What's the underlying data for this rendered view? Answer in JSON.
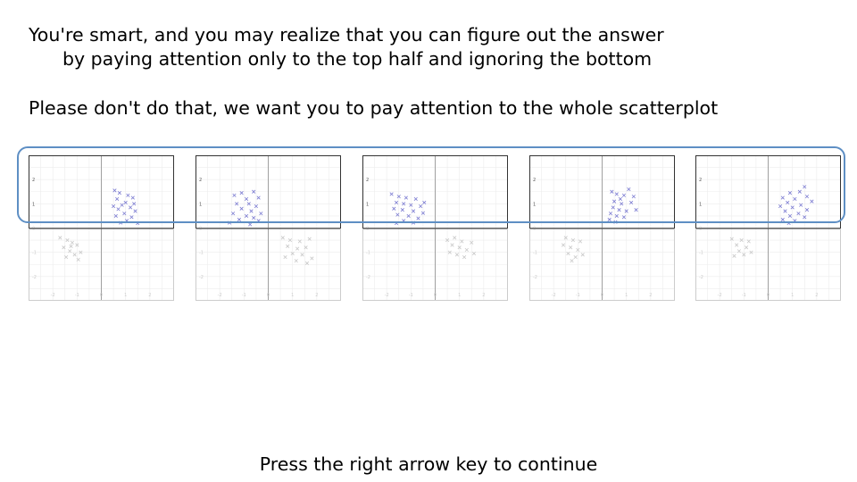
{
  "instructions": {
    "line1": "You're smart, and you may realize that you can figure out the answer",
    "line2": "by paying attention only to the top half and ignoring the bottom",
    "line3": "Please don't do that, we want you to pay attention to the whole scatterplot"
  },
  "footer": {
    "text": "Press the right arrow key to continue"
  },
  "colors": {
    "highlight": "#5e8fc4",
    "points_top": "#7b7bd1",
    "points_bottom": "#c8c8c8",
    "grid": "#ececec",
    "axis": "#a0a0a0",
    "frame_top": "#333333",
    "frame_bottom": "#cccccc"
  },
  "chart_data": [
    {
      "type": "scatter",
      "marker": "x",
      "xlim": [
        -3,
        3
      ],
      "ylim": [
        -3,
        3
      ],
      "y_ticks": [
        "2",
        "1",
        "0",
        "-1",
        "-2"
      ],
      "x_ticks": [
        "-2",
        "-1",
        "0",
        "1",
        "2"
      ],
      "points": [
        [
          0.55,
          1.55
        ],
        [
          0.75,
          1.45
        ],
        [
          1.1,
          1.35
        ],
        [
          1.3,
          1.25
        ],
        [
          0.65,
          1.2
        ],
        [
          1.0,
          1.05
        ],
        [
          0.85,
          0.95
        ],
        [
          1.2,
          0.85
        ],
        [
          0.7,
          0.78
        ],
        [
          1.4,
          0.7
        ],
        [
          0.95,
          0.6
        ],
        [
          0.6,
          0.5
        ],
        [
          1.25,
          0.45
        ],
        [
          1.05,
          0.3
        ],
        [
          0.8,
          0.22
        ],
        [
          1.5,
          0.2
        ],
        [
          0.5,
          0.9
        ],
        [
          1.35,
          1.0
        ],
        [
          -1.7,
          -0.4
        ],
        [
          -1.4,
          -0.5
        ],
        [
          -1.2,
          -0.6
        ],
        [
          -1.55,
          -0.8
        ],
        [
          -1.0,
          -0.7
        ],
        [
          -1.3,
          -0.95
        ],
        [
          -1.1,
          -1.1
        ],
        [
          -0.85,
          -1.0
        ],
        [
          -1.45,
          -1.2
        ],
        [
          -0.95,
          -1.3
        ],
        [
          -1.25,
          -0.75
        ]
      ]
    },
    {
      "type": "scatter",
      "marker": "x",
      "xlim": [
        -3,
        3
      ],
      "ylim": [
        -3,
        3
      ],
      "y_ticks": [
        "2",
        "1",
        "0",
        "-1",
        "-2"
      ],
      "x_ticks": [
        "-2",
        "-1",
        "0",
        "1",
        "2"
      ],
      "points": [
        [
          -1.4,
          1.35
        ],
        [
          -1.1,
          1.45
        ],
        [
          -0.6,
          1.5
        ],
        [
          -0.9,
          1.2
        ],
        [
          -0.4,
          1.25
        ],
        [
          -1.3,
          1.0
        ],
        [
          -0.8,
          1.0
        ],
        [
          -0.5,
          0.9
        ],
        [
          -1.1,
          0.8
        ],
        [
          -0.7,
          0.7
        ],
        [
          -1.45,
          0.6
        ],
        [
          -0.3,
          0.6
        ],
        [
          -0.9,
          0.5
        ],
        [
          -0.6,
          0.42
        ],
        [
          -1.2,
          0.35
        ],
        [
          -0.4,
          0.3
        ],
        [
          -1.6,
          0.22
        ],
        [
          -0.75,
          0.15
        ],
        [
          0.6,
          -0.4
        ],
        [
          0.9,
          -0.5
        ],
        [
          1.3,
          -0.55
        ],
        [
          1.7,
          -0.45
        ],
        [
          0.8,
          -0.75
        ],
        [
          1.2,
          -0.85
        ],
        [
          1.55,
          -0.8
        ],
        [
          1.0,
          -1.05
        ],
        [
          1.4,
          -1.1
        ],
        [
          0.7,
          -1.2
        ],
        [
          1.8,
          -1.25
        ],
        [
          1.15,
          -1.35
        ],
        [
          1.6,
          -1.45
        ]
      ]
    },
    {
      "type": "scatter",
      "marker": "x",
      "xlim": [
        -3,
        3
      ],
      "ylim": [
        -3,
        3
      ],
      "y_ticks": [
        "2",
        "1",
        "0",
        "-1",
        "-2"
      ],
      "x_ticks": [
        "-2",
        "-1",
        "0",
        "1",
        "2"
      ],
      "points": [
        [
          -1.8,
          1.4
        ],
        [
          -1.5,
          1.3
        ],
        [
          -1.2,
          1.25
        ],
        [
          -0.8,
          1.2
        ],
        [
          -1.6,
          1.05
        ],
        [
          -1.3,
          1.0
        ],
        [
          -1.0,
          0.95
        ],
        [
          -0.6,
          0.9
        ],
        [
          -1.7,
          0.8
        ],
        [
          -1.35,
          0.75
        ],
        [
          -0.9,
          0.7
        ],
        [
          -0.5,
          0.62
        ],
        [
          -1.55,
          0.55
        ],
        [
          -1.1,
          0.5
        ],
        [
          -0.7,
          0.4
        ],
        [
          -1.3,
          0.3
        ],
        [
          -0.9,
          0.22
        ],
        [
          -1.6,
          0.2
        ],
        [
          -0.45,
          1.05
        ],
        [
          0.5,
          -0.5
        ],
        [
          0.8,
          -0.4
        ],
        [
          1.1,
          -0.55
        ],
        [
          1.5,
          -0.6
        ],
        [
          0.7,
          -0.7
        ],
        [
          1.0,
          -0.8
        ],
        [
          1.3,
          -0.9
        ],
        [
          0.6,
          -1.0
        ],
        [
          0.9,
          -1.1
        ],
        [
          1.2,
          -1.2
        ],
        [
          1.6,
          -1.05
        ]
      ]
    },
    {
      "type": "scatter",
      "marker": "x",
      "xlim": [
        -3,
        3
      ],
      "ylim": [
        -3,
        3
      ],
      "y_ticks": [
        "2",
        "1",
        "0",
        "-1",
        "-2"
      ],
      "x_ticks": [
        "-2",
        "-1",
        "0",
        "1",
        "2"
      ],
      "points": [
        [
          1.1,
          1.6
        ],
        [
          0.6,
          1.4
        ],
        [
          0.9,
          1.35
        ],
        [
          1.3,
          1.3
        ],
        [
          0.5,
          1.1
        ],
        [
          0.8,
          1.0
        ],
        [
          1.2,
          1.05
        ],
        [
          0.45,
          0.85
        ],
        [
          0.7,
          0.75
        ],
        [
          1.0,
          0.7
        ],
        [
          0.35,
          0.6
        ],
        [
          0.6,
          0.5
        ],
        [
          0.9,
          0.45
        ],
        [
          0.3,
          0.35
        ],
        [
          0.55,
          0.25
        ],
        [
          1.4,
          0.75
        ],
        [
          0.75,
          1.2
        ],
        [
          0.4,
          1.5
        ],
        [
          -1.5,
          -0.4
        ],
        [
          -1.2,
          -0.5
        ],
        [
          -0.9,
          -0.55
        ],
        [
          -1.6,
          -0.7
        ],
        [
          -1.3,
          -0.8
        ],
        [
          -1.0,
          -0.9
        ],
        [
          -1.4,
          -1.05
        ],
        [
          -1.1,
          -1.2
        ],
        [
          -0.8,
          -1.1
        ],
        [
          -1.25,
          -1.35
        ]
      ]
    },
    {
      "type": "scatter",
      "marker": "x",
      "xlim": [
        -3,
        3
      ],
      "ylim": [
        -3,
        3
      ],
      "y_ticks": [
        "2",
        "1",
        "0",
        "-1",
        "-2"
      ],
      "x_ticks": [
        "-2",
        "-1",
        "0",
        "1",
        "2"
      ],
      "points": [
        [
          1.5,
          1.7
        ],
        [
          1.3,
          1.5
        ],
        [
          0.9,
          1.45
        ],
        [
          1.6,
          1.3
        ],
        [
          0.6,
          1.25
        ],
        [
          1.1,
          1.2
        ],
        [
          1.8,
          1.1
        ],
        [
          0.8,
          1.05
        ],
        [
          1.35,
          0.95
        ],
        [
          0.5,
          0.9
        ],
        [
          1.0,
          0.85
        ],
        [
          1.6,
          0.75
        ],
        [
          0.7,
          0.7
        ],
        [
          1.25,
          0.6
        ],
        [
          0.9,
          0.5
        ],
        [
          1.5,
          0.45
        ],
        [
          0.6,
          0.35
        ],
        [
          1.1,
          0.3
        ],
        [
          0.85,
          0.2
        ],
        [
          -1.5,
          -0.45
        ],
        [
          -1.1,
          -0.5
        ],
        [
          -0.8,
          -0.55
        ],
        [
          -1.3,
          -0.7
        ],
        [
          -0.9,
          -0.8
        ],
        [
          -1.2,
          -0.95
        ],
        [
          -1.0,
          -1.1
        ],
        [
          -1.4,
          -1.15
        ],
        [
          -0.7,
          -1.0
        ]
      ]
    }
  ]
}
